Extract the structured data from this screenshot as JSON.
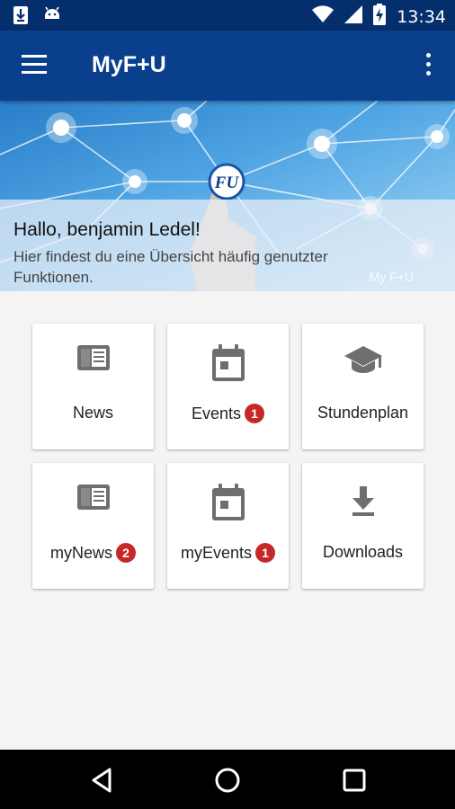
{
  "status_bar": {
    "time": "13:34",
    "icons": [
      "download-icon",
      "android-icon",
      "wifi-icon",
      "signal-icon",
      "battery-charging-icon"
    ]
  },
  "app_bar": {
    "title": "MyF+U",
    "icons": [
      "menu-icon",
      "more-vert-icon"
    ]
  },
  "banner": {
    "greeting": "Hallo, benjamin Ledel!",
    "subtext": "Hier findest du eine Übersicht häufig genutzter Funktionen.",
    "logo_text": "FU",
    "watermark": "My F+U"
  },
  "tiles": [
    {
      "label": "News",
      "icon": "newspaper-icon",
      "badge": ""
    },
    {
      "label": "Events",
      "icon": "calendar-icon",
      "badge": "1"
    },
    {
      "label": "Stundenplan",
      "icon": "school-icon",
      "badge": ""
    },
    {
      "label": "myNews",
      "icon": "newspaper-icon",
      "badge": "2"
    },
    {
      "label": "myEvents",
      "icon": "calendar-icon",
      "badge": "1"
    },
    {
      "label": "Downloads",
      "icon": "download-icon",
      "badge": ""
    }
  ],
  "colors": {
    "status_bar": "#052f6c",
    "app_bar": "#0a3f8d",
    "badge": "#c62828",
    "icon_gray": "#6e6e6e"
  },
  "nav_bar": {
    "buttons": [
      "back-icon",
      "home-icon",
      "recents-icon"
    ]
  }
}
